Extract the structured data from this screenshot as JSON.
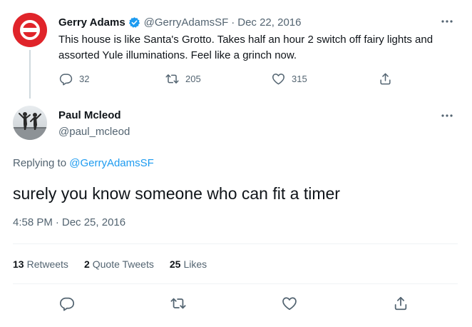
{
  "parent_tweet": {
    "author_name": "Gerry Adams",
    "handle": "@GerryAdamsSF",
    "separator": "·",
    "date": "Dec 22, 2016",
    "text": "This house is like Santa's Grotto. Takes half an hour 2 switch off fairy lights and assorted Yule illuminations. Feel like a grinch now.",
    "actions": {
      "reply_count": "32",
      "retweet_count": "205",
      "like_count": "315"
    }
  },
  "main_tweet": {
    "author_name": "Paul Mcleod",
    "handle": "@paul_mcleod",
    "replying_prefix": "Replying to ",
    "replying_to": "@GerryAdamsSF",
    "text": "surely you know someone who can fit a timer",
    "time": "4:58 PM",
    "separator": "·",
    "date": "Dec 25, 2016",
    "stats": {
      "retweets_count": "13",
      "retweets_label": "Retweets",
      "quote_count": "2",
      "quote_label": "Quote Tweets",
      "likes_count": "25",
      "likes_label": "Likes"
    }
  },
  "icons": [
    "more-icon",
    "verified-icon",
    "reply-icon",
    "retweet-icon",
    "like-icon",
    "share-icon"
  ],
  "colors": {
    "accent": "#1d9bf0",
    "text": "#0f1419",
    "muted": "#536471",
    "brand_red": "#e0242a"
  }
}
